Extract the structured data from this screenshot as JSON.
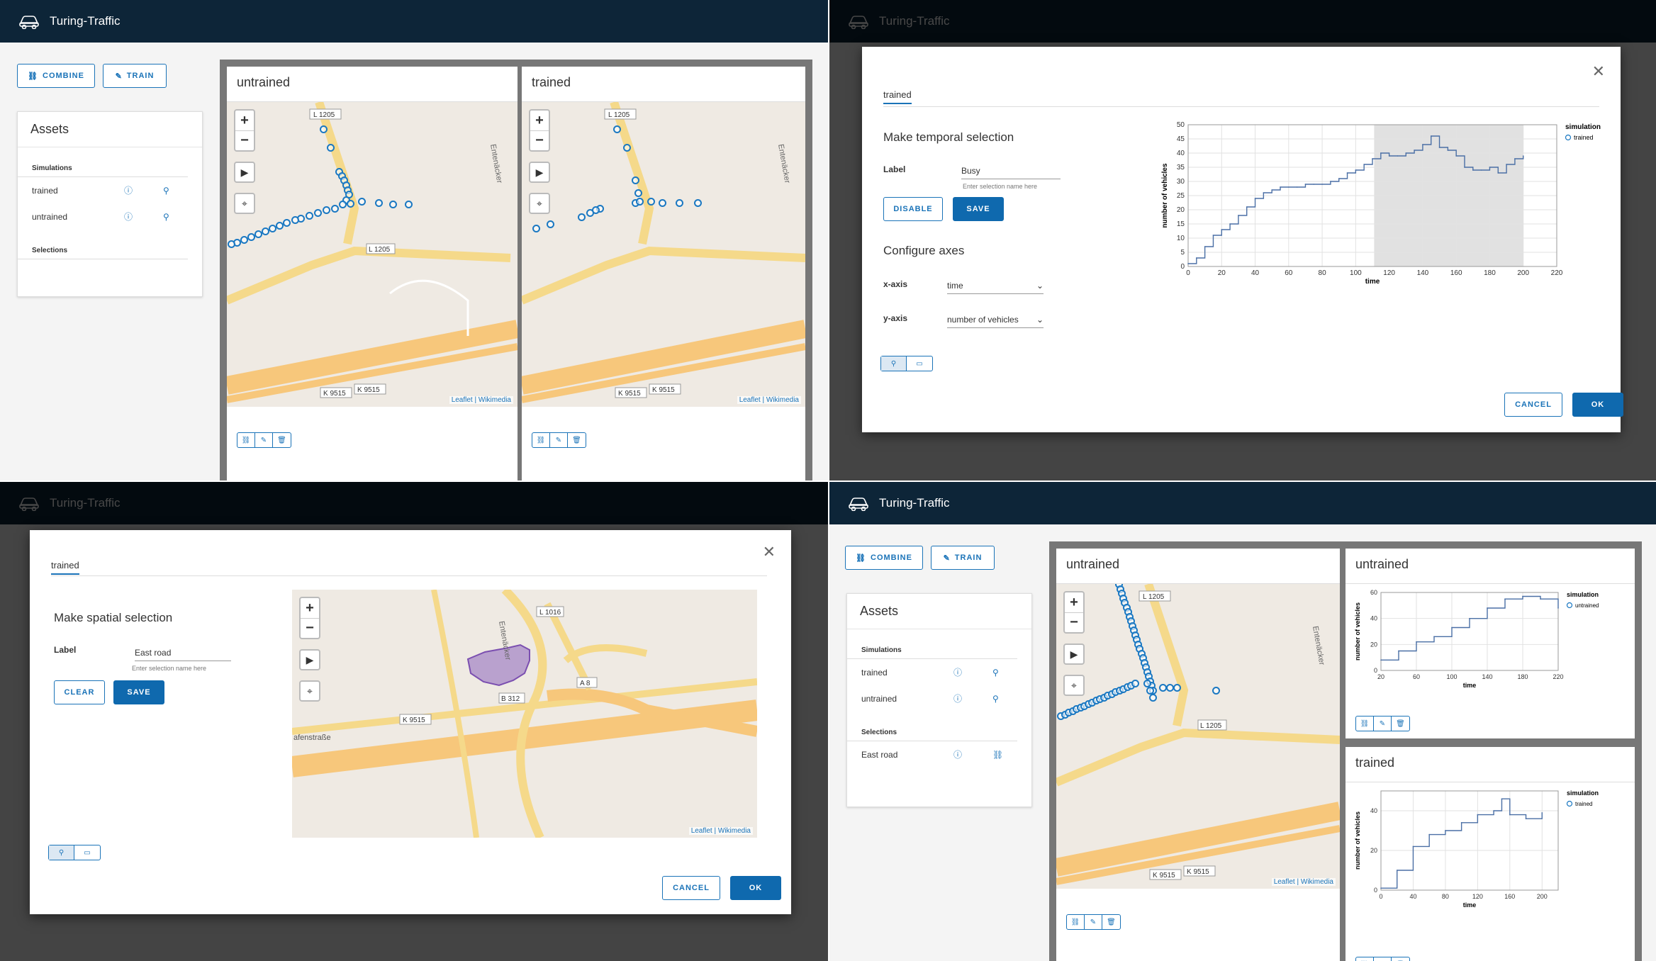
{
  "app": {
    "title": "Turing-Traffic"
  },
  "toolbar": {
    "combine_label": "COMBINE",
    "train_label": "TRAIN"
  },
  "assets": {
    "title": "Assets",
    "simulations_heading": "Simulations",
    "simulations": [
      "trained",
      "untrained"
    ],
    "selections_heading": "Selections",
    "selections_q4": [
      "East road"
    ]
  },
  "maps": {
    "untrained_title": "untrained",
    "trained_title": "trained",
    "attribution_leaflet": "Leaflet",
    "attribution_sep": " | ",
    "attribution_wiki": "Wikimedia",
    "road_labels": [
      "L 1205",
      "L 1205",
      "K 9515",
      "K 9515",
      "K 9515",
      "Entenäcker",
      "L 1016",
      "A 8",
      "B 312",
      "K 9515",
      "afenstraße"
    ]
  },
  "temporal_modal": {
    "tab": "trained",
    "heading": "Make temporal selection",
    "label_label": "Label",
    "label_value": "Busy",
    "label_hint": "Enter selection name here",
    "disable_label": "DISABLE",
    "save_label": "SAVE",
    "axes_heading": "Configure axes",
    "xaxis_label": "x-axis",
    "xaxis_value": "time",
    "yaxis_label": "y-axis",
    "yaxis_value": "number of vehicles",
    "cancel_label": "CANCEL",
    "ok_label": "OK"
  },
  "spatial_modal": {
    "tab": "trained",
    "heading": "Make spatial selection",
    "label_label": "Label",
    "label_value": "East road",
    "label_hint": "Enter selection name here",
    "clear_label": "CLEAR",
    "save_label": "SAVE",
    "cancel_label": "CANCEL",
    "ok_label": "OK"
  },
  "chart_data": [
    {
      "type": "line",
      "title": "",
      "xlabel": "time",
      "ylabel": "number of vehicles",
      "legend_title": "simulation",
      "series": [
        {
          "name": "trained",
          "x": [
            0,
            5,
            10,
            15,
            20,
            25,
            30,
            35,
            40,
            45,
            50,
            55,
            60,
            65,
            70,
            75,
            80,
            85,
            90,
            95,
            100,
            105,
            110,
            115,
            120,
            125,
            130,
            135,
            140,
            145,
            150,
            155,
            160,
            165,
            170,
            175,
            180,
            185,
            190,
            195,
            200
          ],
          "y": [
            1,
            3,
            7,
            11,
            13,
            15,
            18,
            21,
            24,
            26,
            27,
            28,
            28,
            28,
            29,
            29,
            29,
            30,
            31,
            33,
            34,
            36,
            38,
            40,
            39,
            39,
            40,
            41,
            43,
            46,
            42,
            41,
            39,
            35,
            34,
            34,
            35,
            33,
            36,
            38,
            39
          ]
        }
      ],
      "xlim": [
        0,
        220
      ],
      "ylim": [
        0,
        50
      ],
      "xticks": [
        0,
        20,
        40,
        60,
        80,
        100,
        120,
        140,
        160,
        180,
        200,
        220
      ],
      "yticks": [
        0,
        5,
        10,
        15,
        20,
        25,
        30,
        35,
        40,
        45,
        50
      ],
      "highlight_x": [
        111,
        200
      ],
      "legend": "top-right"
    },
    {
      "type": "line",
      "title": "untrained",
      "xlabel": "time",
      "ylabel": "number of vehicles",
      "legend_title": "simulation",
      "series": [
        {
          "name": "untrained",
          "x": [
            20,
            40,
            60,
            80,
            100,
            120,
            140,
            160,
            180,
            200,
            220
          ],
          "y": [
            8,
            15,
            22,
            26,
            33,
            40,
            48,
            55,
            57,
            55,
            48
          ]
        }
      ],
      "xlim": [
        20,
        220
      ],
      "ylim": [
        0,
        60
      ],
      "xticks": [
        20,
        60,
        100,
        140,
        180,
        220
      ],
      "yticks": [
        0,
        20,
        40,
        60
      ],
      "legend": "top-right"
    },
    {
      "type": "line",
      "title": "trained",
      "xlabel": "time",
      "ylabel": "number of vehicles",
      "legend_title": "simulation",
      "series": [
        {
          "name": "trained",
          "x": [
            0,
            20,
            40,
            60,
            80,
            100,
            120,
            140,
            150,
            160,
            180,
            200
          ],
          "y": [
            1,
            10,
            22,
            28,
            30,
            34,
            38,
            40,
            46,
            38,
            36,
            39
          ]
        }
      ],
      "xlim": [
        0,
        220
      ],
      "ylim": [
        0,
        50
      ],
      "xticks": [
        0,
        40,
        80,
        120,
        160,
        200
      ],
      "yticks": [
        0,
        20,
        40
      ],
      "legend": "top-right"
    }
  ]
}
